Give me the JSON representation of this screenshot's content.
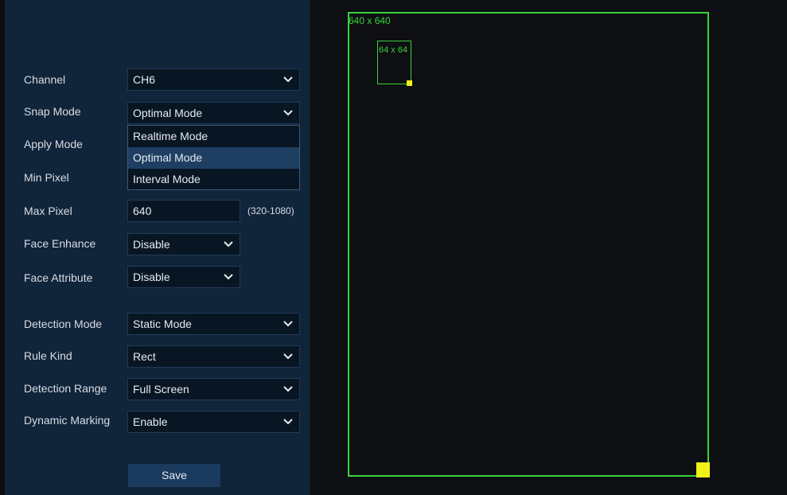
{
  "form": {
    "channel": {
      "label": "Channel",
      "value": "CH6"
    },
    "snap_mode": {
      "label": "Snap Mode",
      "value": "Optimal Mode"
    },
    "apply_mode": {
      "label": "Apply Mode"
    },
    "min_pixel": {
      "label": "Min Pixel"
    },
    "max_pixel": {
      "label": "Max Pixel",
      "value": "640",
      "range_hint": "(320-1080)"
    },
    "face_enhance": {
      "label": "Face Enhance",
      "value": "Disable"
    },
    "face_attribute": {
      "label": "Face Attribute",
      "value": "Disable"
    },
    "detection_mode": {
      "label": "Detection Mode",
      "value": "Static Mode"
    },
    "rule_kind": {
      "label": "Rule Kind",
      "value": "Rect"
    },
    "detection_range": {
      "label": "Detection Range",
      "value": "Full Screen"
    },
    "dynamic_marking": {
      "label": "Dynamic Marking",
      "value": "Enable"
    }
  },
  "snap_mode_dropdown": {
    "options": [
      "Realtime Mode",
      "Optimal Mode",
      "Interval Mode"
    ],
    "selected": "Optimal Mode"
  },
  "save_label": "Save",
  "preview": {
    "max_box_label": "640 x 640",
    "min_box_label": "64 x 64",
    "box_color": "#3bd13b",
    "handle_color": "#f2f21a"
  },
  "colors": {
    "panel_bg": "#10243a",
    "control_bg": "#081624",
    "highlight": "#1e3f62",
    "button_bg": "#1a3a5e"
  }
}
